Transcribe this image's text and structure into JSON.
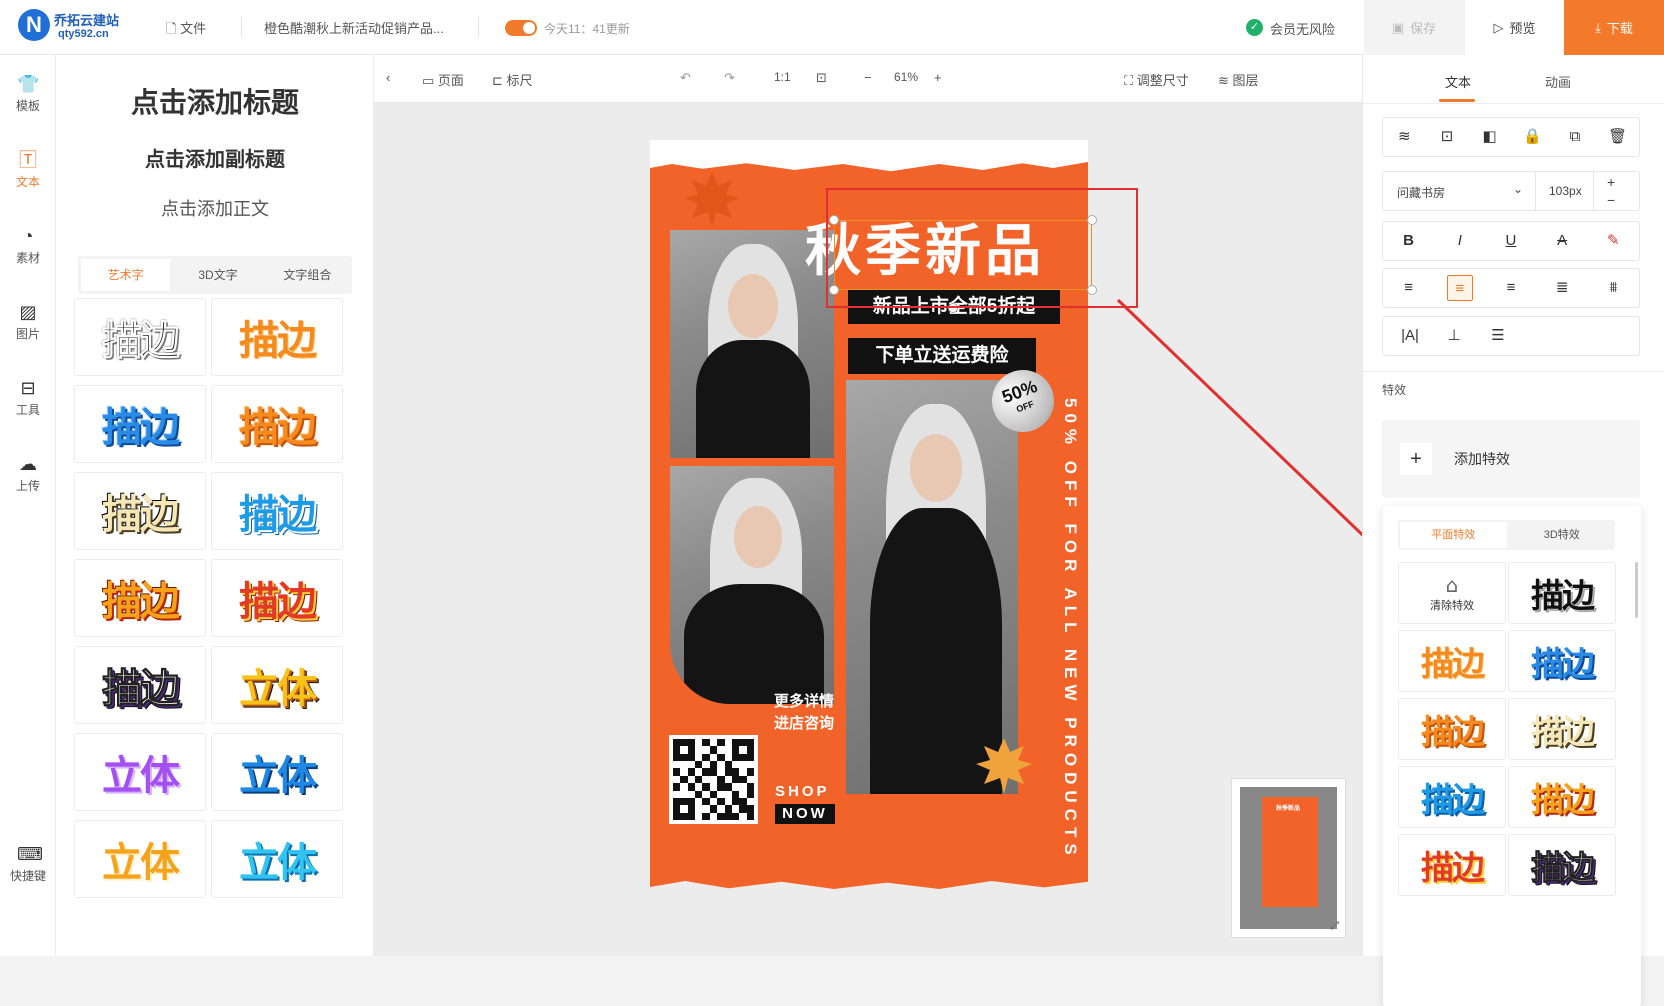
{
  "topbar": {
    "logo_letter": "N",
    "logo_name": "乔拓云建站",
    "logo_domain": "qty592.cn",
    "file_label": "文件",
    "doc_title": "橙色酷潮秋上新活动促销产品...",
    "autosave_text": "今天11：41更新",
    "member_text": "会员无风险",
    "save_label": "保存",
    "preview_label": "预览",
    "download_label": "下载"
  },
  "rail": {
    "items": [
      {
        "label": "模板",
        "icon": "template-icon"
      },
      {
        "label": "文本",
        "icon": "text-icon"
      },
      {
        "label": "素材",
        "icon": "material-icon"
      },
      {
        "label": "图片",
        "icon": "image-icon"
      },
      {
        "label": "工具",
        "icon": "toolbox-icon"
      },
      {
        "label": "上传",
        "icon": "upload-icon"
      }
    ],
    "shortcut_label": "快捷键"
  },
  "textpanel": {
    "add_title": "点击添加标题",
    "add_subtitle": "点击添加副标题",
    "add_body": "点击添加正文",
    "tabs": [
      "艺术字",
      "3D文字",
      "文字组合"
    ],
    "art_items": [
      "描边",
      "描边",
      "描边",
      "描边",
      "描边",
      "描边",
      "描边",
      "描边",
      "描边",
      "立体",
      "立体",
      "立体",
      "立体",
      "立体"
    ]
  },
  "canvas_toolbar": {
    "page_label": "页面",
    "ruler_label": "标尺",
    "ratio_label": "1:1",
    "zoom_value": "61%",
    "resize_label": "调整尺寸",
    "layers_label": "图层"
  },
  "poster": {
    "title": "秋季新品",
    "line1": "新品上市全部5折起",
    "line2": "下单立送运费险",
    "badge_top": "50%",
    "badge_bottom": "OFF",
    "vertical": "50% OFF FOR ALL NEW PRODUCTS",
    "more1": "更多详情",
    "more2": "进店咨询",
    "shop": "SHOP",
    "now": "NOW"
  },
  "minimap": {
    "title": "秋季新品"
  },
  "rightpanel": {
    "tabs": [
      "文本",
      "动画"
    ],
    "font_name": "问藏书房",
    "font_size": "103px",
    "format_icons": [
      "B",
      "I",
      "U",
      "A",
      "✎"
    ],
    "effects_label": "特效",
    "add_effect_label": "添加特效",
    "fx_tabs": [
      "平面特效",
      "3D特效"
    ],
    "clear_effect_label": "清除特效",
    "fx_items": [
      "描边",
      "描边",
      "描边",
      "描边",
      "描边",
      "描边",
      "描边",
      "描边",
      "描边"
    ]
  },
  "colors": {
    "accent": "#f07a2a",
    "poster_bg": "#f2632a",
    "selection": "#e23030"
  }
}
